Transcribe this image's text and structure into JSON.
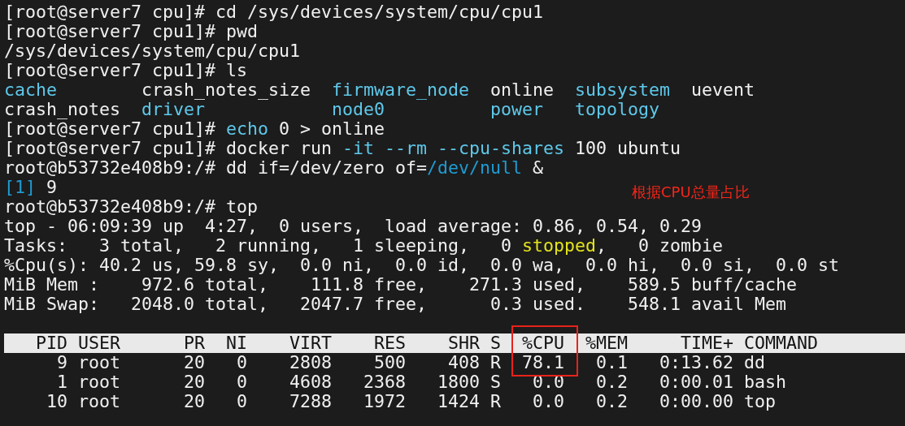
{
  "terminal": {
    "lines": [
      {
        "kind": "line",
        "segments": [
          {
            "kind": "text",
            "text": "[root@server7 cpu]# cd /sys/devices/system/cpu/cpu1"
          }
        ]
      },
      {
        "kind": "line",
        "segments": [
          {
            "kind": "text",
            "text": "[root@server7 cpu1]# pwd"
          }
        ]
      },
      {
        "kind": "line",
        "segments": [
          {
            "kind": "text",
            "text": "/sys/devices/system/cpu/cpu1"
          }
        ]
      },
      {
        "kind": "line",
        "segments": [
          {
            "kind": "text",
            "text": "[root@server7 cpu1]# ls"
          }
        ]
      },
      {
        "kind": "listing",
        "items": [
          {
            "kind": "dir",
            "text": "cache"
          },
          {
            "kind": "file",
            "text": "crash_notes_size"
          },
          {
            "kind": "dir",
            "text": "firmware_node"
          },
          {
            "kind": "file",
            "text": "online"
          },
          {
            "kind": "dir",
            "text": "subsystem"
          },
          {
            "kind": "file",
            "text": "uevent"
          },
          {
            "kind": "file",
            "text": "crash_notes"
          },
          {
            "kind": "dir",
            "text": "driver"
          },
          {
            "kind": "dir",
            "text": "node0"
          },
          {
            "kind": "dir",
            "text": "power"
          },
          {
            "kind": "dir",
            "text": "topology"
          }
        ]
      },
      {
        "kind": "line",
        "segments": [
          {
            "kind": "text",
            "text": "[root@server7 cpu1]# "
          },
          {
            "kind": "command",
            "text": "echo"
          },
          {
            "kind": "text",
            "text": " 0 > online"
          }
        ]
      },
      {
        "kind": "line",
        "segments": [
          {
            "kind": "text",
            "text": "[root@server7 cpu1]# docker run "
          },
          {
            "kind": "option",
            "text": "-it --rm --cpu-shares"
          },
          {
            "kind": "text",
            "text": " 100 ubuntu"
          }
        ]
      },
      {
        "kind": "line",
        "segments": [
          {
            "kind": "text",
            "text": "root@b53732e408b9:/# dd if=/dev/zero of="
          },
          {
            "kind": "path",
            "text": "/dev/null"
          },
          {
            "kind": "text",
            "text": " &"
          }
        ]
      },
      {
        "kind": "line",
        "segments": [
          {
            "kind": "job",
            "text": "[1]"
          },
          {
            "kind": "text",
            "text": " 9"
          }
        ]
      },
      {
        "kind": "line",
        "segments": [
          {
            "kind": "text",
            "text": "root@b53732e408b9:/# top"
          }
        ]
      },
      {
        "kind": "line",
        "segments": [
          {
            "kind": "text",
            "text": "top - 06:09:39 up  4:27,  0 users,  load average: 0.86, 0.54, 0.29"
          }
        ]
      },
      {
        "kind": "line",
        "segments": [
          {
            "kind": "text",
            "text": "Tasks:   3 total,   2 running,   1 sleeping,   0 "
          },
          {
            "kind": "status",
            "text": "stopped"
          },
          {
            "kind": "text",
            "text": ",   0 zombie"
          }
        ]
      },
      {
        "kind": "line",
        "segments": [
          {
            "kind": "text",
            "text": "%Cpu(s): 40.2 us, 59.8 sy,  0.0 ni,  0.0 id,  0.0 wa,  0.0 hi,  0.0 si,  0.0 st"
          }
        ]
      },
      {
        "kind": "line",
        "segments": [
          {
            "kind": "text",
            "text": "MiB Mem :    972.6 total,    111.8 free,    271.3 used,    589.5 buff/cache"
          }
        ]
      },
      {
        "kind": "line",
        "segments": [
          {
            "kind": "text",
            "text": "MiB Swap:   2048.0 total,   2047.7 free,      0.3 used.    548.1 avail Mem"
          }
        ]
      },
      {
        "kind": "blank"
      }
    ]
  },
  "process_table": {
    "columns": [
      {
        "label": "PID",
        "highlighted": false
      },
      {
        "label": "USER",
        "highlighted": false
      },
      {
        "label": "PR",
        "highlighted": false
      },
      {
        "label": "NI",
        "highlighted": false
      },
      {
        "label": "VIRT",
        "highlighted": false
      },
      {
        "label": "RES",
        "highlighted": false
      },
      {
        "label": "SHR",
        "highlighted": false
      },
      {
        "label": "S",
        "highlighted": false
      },
      {
        "label": "%CPU",
        "highlighted": true
      },
      {
        "label": "%MEM",
        "highlighted": false
      },
      {
        "label": "TIME+",
        "highlighted": false
      },
      {
        "label": "COMMAND",
        "highlighted": false
      }
    ],
    "rows": [
      {
        "highlighted": true,
        "cells": [
          "9",
          "root",
          "20",
          "0",
          "2808",
          "500",
          "408",
          "R",
          "78.1",
          "0.1",
          "0:13.62",
          "dd"
        ]
      },
      {
        "highlighted": false,
        "cells": [
          "1",
          "root",
          "20",
          "0",
          "4608",
          "2368",
          "1800",
          "S",
          "0.0",
          "0.2",
          "0:00.01",
          "bash"
        ]
      },
      {
        "highlighted": false,
        "cells": [
          "10",
          "root",
          "20",
          "0",
          "7288",
          "1972",
          "1424",
          "R",
          "0.0",
          "0.2",
          "0:00.00",
          "top"
        ]
      }
    ]
  },
  "annotation": {
    "text": "根据CPU总量占比"
  }
}
